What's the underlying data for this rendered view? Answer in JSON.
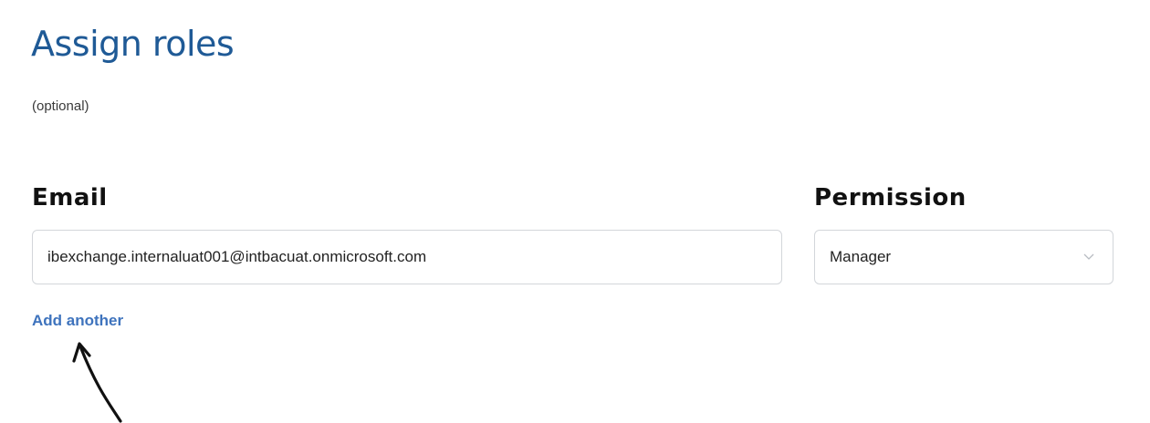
{
  "header": {
    "title": "Assign roles",
    "subtitle": "(optional)"
  },
  "form": {
    "email_label": "Email",
    "permission_label": "Permission",
    "email_value": "ibexchange.internaluat001@intbacuat.onmicrosoft.com",
    "permission_value": "Manager",
    "add_another_label": "Add another"
  },
  "icons": {
    "select_chevron": "chevron-down-icon",
    "annotation": "hand-drawn-arrow-icon"
  },
  "colors": {
    "title": "#1f5a96",
    "link": "#3e73bd",
    "border": "#d3d6da"
  }
}
